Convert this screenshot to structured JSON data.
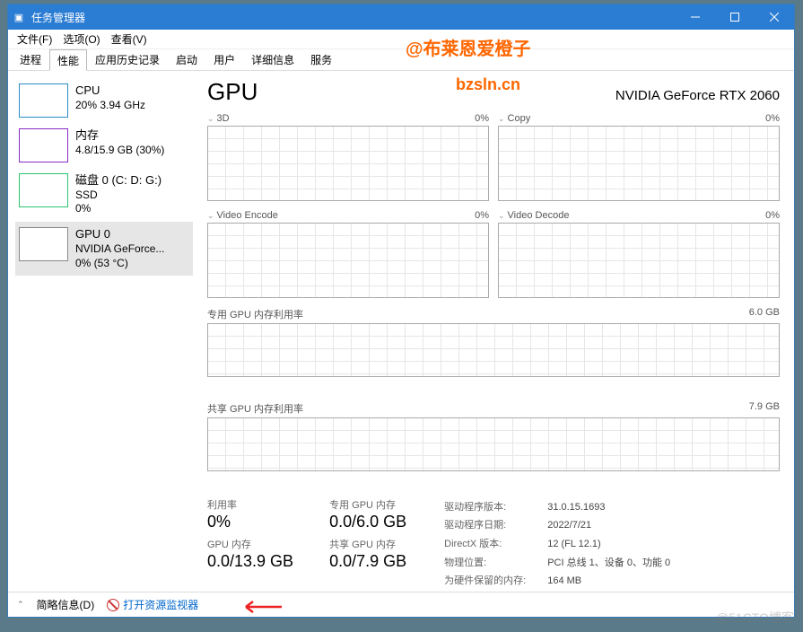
{
  "titlebar": {
    "title": "任务管理器"
  },
  "menubar": {
    "file": "文件(F)",
    "options": "选项(O)",
    "view": "查看(V)"
  },
  "tabs": {
    "t0": "进程",
    "t1": "性能",
    "t2": "应用历史记录",
    "t3": "启动",
    "t4": "用户",
    "t5": "详细信息",
    "t6": "服务"
  },
  "sidebar": {
    "cpu": {
      "name": "CPU",
      "sub": "20% 3.94 GHz"
    },
    "mem": {
      "name": "内存",
      "sub": "4.8/15.9 GB (30%)"
    },
    "disk": {
      "name": "磁盘 0 (C: D: G:)",
      "sub1": "SSD",
      "sub2": "0%"
    },
    "gpu": {
      "name": "GPU 0",
      "sub1": "NVIDIA GeForce...",
      "sub2": "0% (53 °C)"
    }
  },
  "main": {
    "title": "GPU",
    "model": "NVIDIA GeForce RTX 2060",
    "c3d": {
      "label": "3D",
      "pct": "0%"
    },
    "copy": {
      "label": "Copy",
      "pct": "0%"
    },
    "venc": {
      "label": "Video Encode",
      "pct": "0%"
    },
    "vdec": {
      "label": "Video Decode",
      "pct": "0%"
    },
    "dedmem": {
      "label": "专用 GPU 内存利用率",
      "max": "6.0 GB"
    },
    "shmem": {
      "label": "共享 GPU 内存利用率",
      "max": "7.9 GB"
    }
  },
  "stats": {
    "util": {
      "lbl": "利用率",
      "val": "0%"
    },
    "gpumem": {
      "lbl": "GPU 内存",
      "val": "0.0/13.9 GB"
    },
    "dedmem": {
      "lbl": "专用 GPU 内存",
      "val": "0.0/6.0 GB"
    },
    "shmem": {
      "lbl": "共享 GPU 内存",
      "val": "0.0/7.9 GB"
    }
  },
  "props": {
    "drv_ver_l": "驱动程序版本:",
    "drv_ver_v": "31.0.15.1693",
    "drv_date_l": "驱动程序日期:",
    "drv_date_v": "2022/7/21",
    "dx_l": "DirectX 版本:",
    "dx_v": "12 (FL 12.1)",
    "loc_l": "物理位置:",
    "loc_v": "PCI 总线 1、设备 0、功能 0",
    "res_l": "为硬件保留的内存:",
    "res_v": "164 MB"
  },
  "footer": {
    "brief": "简略信息(D)",
    "resmon": "打开资源监视器"
  },
  "watermark": {
    "handle": "@布莱恩爱橙子",
    "url": "bzsln.cn",
    "blog": "@51CTO博客"
  },
  "chart_data": {
    "type": "line",
    "charts": [
      {
        "name": "3D",
        "ylim": [
          0,
          100
        ],
        "values": []
      },
      {
        "name": "Copy",
        "ylim": [
          0,
          100
        ],
        "values": []
      },
      {
        "name": "Video Encode",
        "ylim": [
          0,
          100
        ],
        "values": []
      },
      {
        "name": "Video Decode",
        "ylim": [
          0,
          100
        ],
        "values": []
      },
      {
        "name": "专用 GPU 内存利用率",
        "ylim": [
          0,
          6.0
        ],
        "unit": "GB",
        "values": []
      },
      {
        "name": "共享 GPU 内存利用率",
        "ylim": [
          0,
          7.9
        ],
        "unit": "GB",
        "values": []
      }
    ]
  }
}
